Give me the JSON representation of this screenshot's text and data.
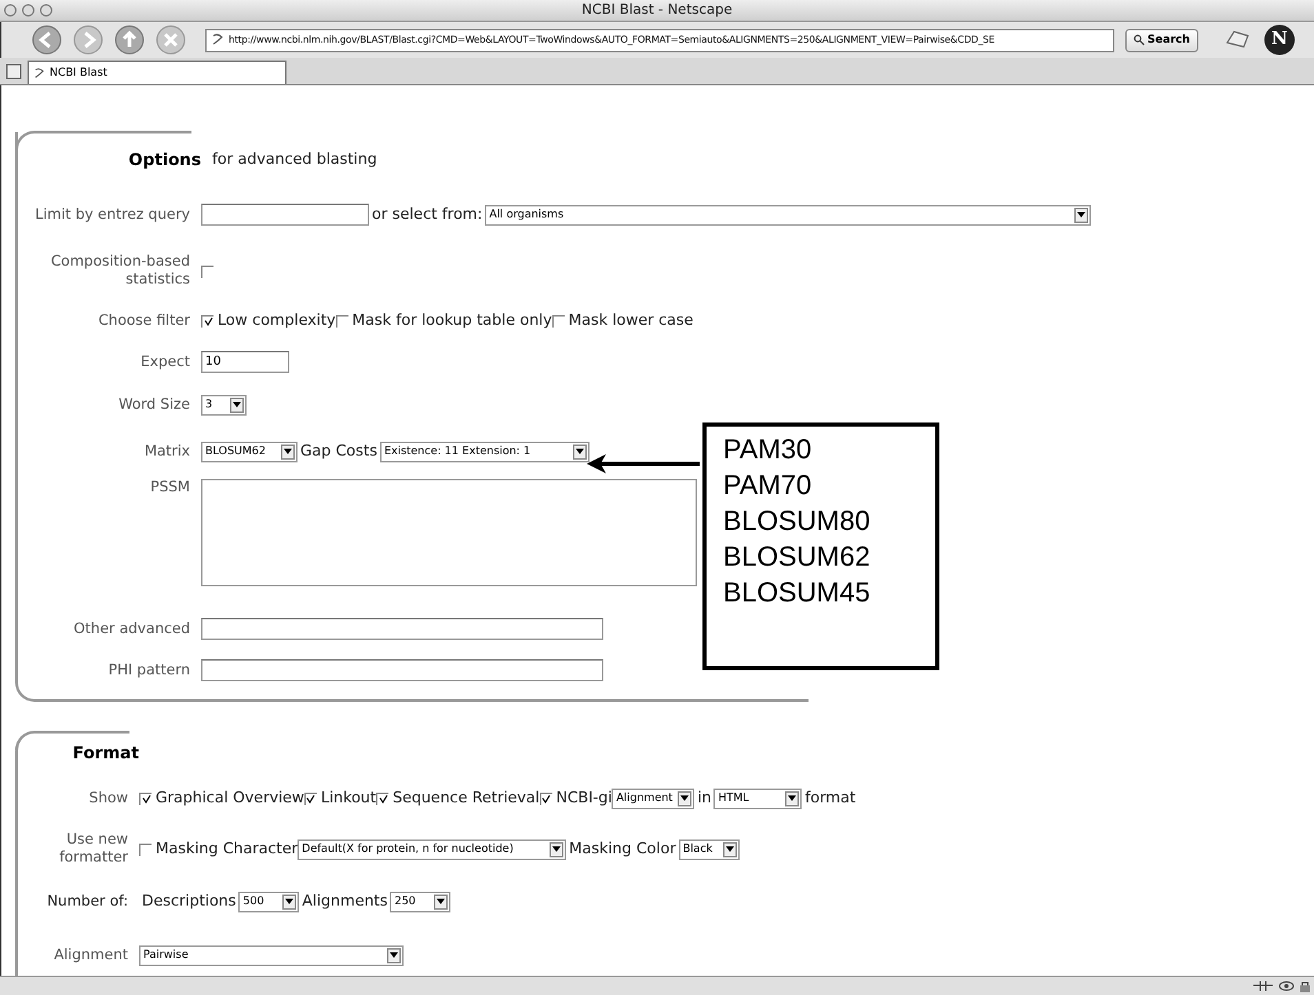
{
  "window": {
    "title": "NCBI Blast - Netscape"
  },
  "toolbar": {
    "url": "http://www.ncbi.nlm.nih.gov/BLAST/Blast.cgi?CMD=Web&LAYOUT=TwoWindows&AUTO_FORMAT=Semiauto&ALIGNMENTS=250&ALIGNMENT_VIEW=Pairwise&CDD_SE",
    "search_button": "Search",
    "logo_letter": "N"
  },
  "tabs": [
    {
      "label": "NCBI Blast",
      "selected": true
    }
  ],
  "options": {
    "heading": "Options",
    "subtitle": "for advanced blasting",
    "rows": [
      {
        "label": "Limit by entrez query",
        "items": [
          {
            "kind": "field",
            "value": ""
          },
          {
            "kind": "text",
            "text": "or select from:"
          },
          {
            "kind": "select",
            "value": "All organisms"
          }
        ]
      },
      {
        "label": "Composition-based statistics",
        "items": [
          {
            "kind": "checkbox",
            "checked": false
          }
        ]
      },
      {
        "label": "Choose filter",
        "items": [
          {
            "kind": "checkbox",
            "checked": true,
            "text": "Low complexity"
          },
          {
            "kind": "checkbox",
            "checked": false,
            "text": "Mask for lookup table only"
          },
          {
            "kind": "checkbox",
            "checked": false,
            "text": "Mask lower case"
          }
        ]
      },
      {
        "label": "Expect",
        "items": [
          {
            "kind": "field",
            "value": "10"
          }
        ]
      },
      {
        "label": "Word Size",
        "items": [
          {
            "kind": "select",
            "value": "3"
          }
        ]
      },
      {
        "label": "Matrix",
        "items": [
          {
            "kind": "select",
            "value": "BLOSUM62"
          },
          {
            "kind": "text",
            "text": "Gap Costs"
          },
          {
            "kind": "select",
            "value": "Existence: 11 Extension: 1"
          }
        ]
      },
      {
        "label": "PSSM",
        "items": [
          {
            "kind": "textarea",
            "value": ""
          }
        ]
      },
      {
        "label": "Other advanced",
        "items": [
          {
            "kind": "field",
            "value": ""
          }
        ]
      },
      {
        "label": "PHI pattern",
        "items": [
          {
            "kind": "field",
            "value": ""
          }
        ]
      }
    ]
  },
  "callout": {
    "items": [
      "PAM30",
      "PAM70",
      "BLOSUM80",
      "BLOSUM62",
      "BLOSUM45"
    ]
  },
  "format": {
    "heading": "Format",
    "rows": [
      {
        "label": "Show",
        "items": [
          {
            "kind": "checkbox",
            "checked": true,
            "text": "Graphical Overview"
          },
          {
            "kind": "checkbox",
            "checked": true,
            "text": "Linkout"
          },
          {
            "kind": "checkbox",
            "checked": true,
            "text": "Sequence Retrieval"
          },
          {
            "kind": "checkbox",
            "checked": true,
            "text": "NCBI-gi"
          },
          {
            "kind": "select",
            "value": "Alignment"
          },
          {
            "kind": "text",
            "text": "in"
          },
          {
            "kind": "select",
            "value": "HTML"
          },
          {
            "kind": "text",
            "text": "format"
          }
        ]
      },
      {
        "label": "Use new formatter",
        "items": [
          {
            "kind": "checkbox",
            "checked": false,
            "text": "Masking Character"
          },
          {
            "kind": "select",
            "value": "Default(X for protein, n for nucleotide)"
          },
          {
            "kind": "text",
            "text": "Masking Color"
          },
          {
            "kind": "select",
            "value": "Black"
          }
        ]
      },
      {
        "label": "Number of:",
        "items": [
          {
            "kind": "text",
            "text": "Descriptions"
          },
          {
            "kind": "select",
            "value": "500"
          },
          {
            "kind": "text",
            "text": "Alignments"
          },
          {
            "kind": "select",
            "value": "250"
          }
        ]
      },
      {
        "label": "Alignment",
        "items": [
          {
            "kind": "select",
            "value": "Pairwise"
          }
        ]
      }
    ]
  }
}
